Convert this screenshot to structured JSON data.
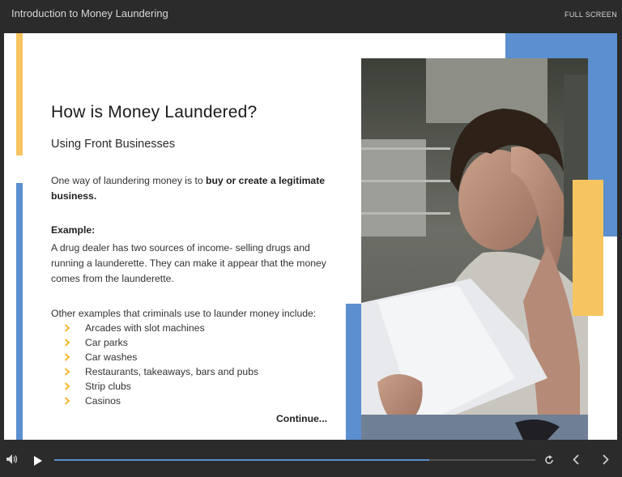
{
  "header": {
    "course_title": "Introduction to Money Laundering",
    "fullscreen_label": "FULL SCREEN"
  },
  "slide": {
    "title": "How is Money Laundered?",
    "subtitle": "Using Front Businesses",
    "intro_prefix": "One way of laundering money is to ",
    "intro_bold": "buy or create a legitimate business.",
    "example_label": "Example:",
    "example_text": "A drug dealer has two sources of income- selling drugs and running a launderette. They can make it appear that the money comes from the launderette.",
    "others_intro": "Other examples that criminals use to launder money include:",
    "examples": [
      "Arcades with slot machines",
      "Car parks",
      "Car washes",
      "Restaurants, takeaways, bars and pubs",
      "Strip clubs",
      "Casinos"
    ],
    "continue_label": "Continue...",
    "photo_subject": "stressed man reading paperwork",
    "colors": {
      "accent_blue": "#5b8fcf",
      "accent_yellow": "#f7c55f",
      "bullet_chevron": "#f5b82e"
    }
  },
  "player": {
    "icons": [
      "volume-icon",
      "play-icon",
      "replay-icon",
      "previous-icon",
      "next-icon"
    ],
    "progress_fraction": 0.78
  }
}
